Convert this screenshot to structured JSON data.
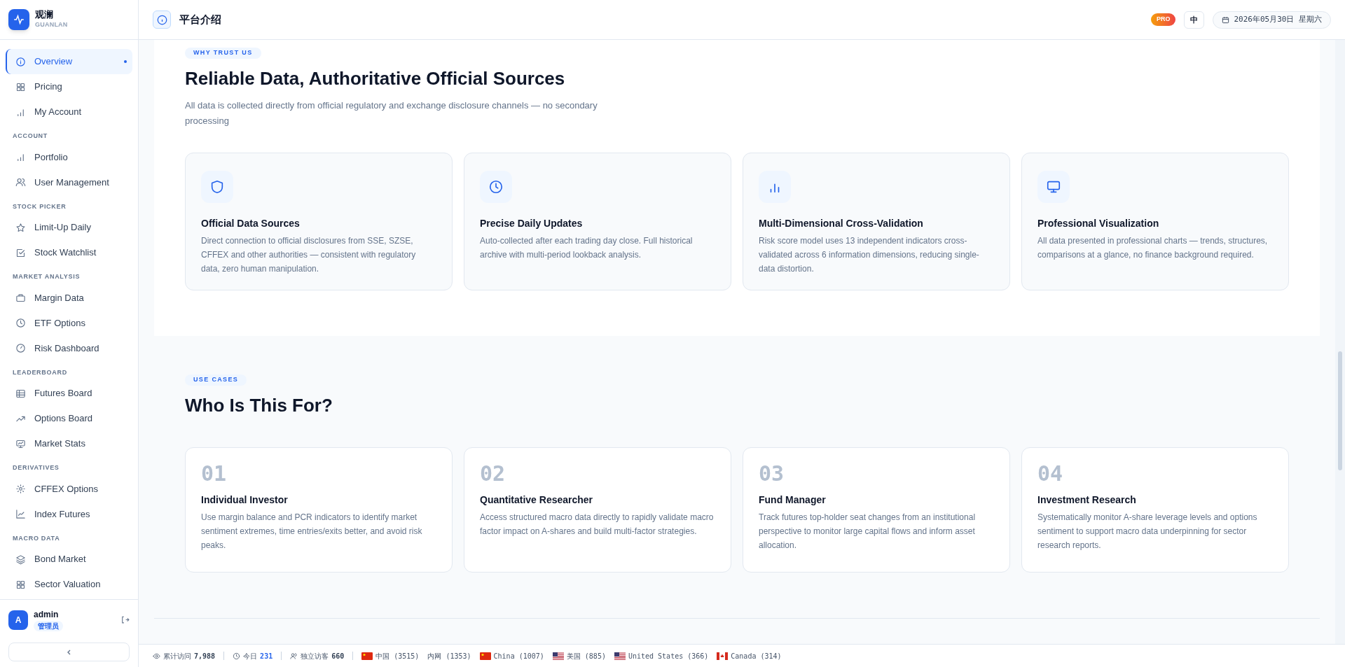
{
  "brand": {
    "name": "观澜",
    "subtitle": "GUANLAN"
  },
  "sidebar": {
    "groups": [
      {
        "items": [
          {
            "label": "Overview",
            "selected": true
          },
          {
            "label": "Pricing",
            "selected": false
          },
          {
            "label": "My Account",
            "selected": false
          }
        ]
      },
      {
        "heading": "ACCOUNT",
        "items": [
          {
            "label": "Portfolio",
            "selected": false
          },
          {
            "label": "User Management",
            "selected": false
          }
        ]
      },
      {
        "heading": "STOCK PICKER",
        "items": [
          {
            "label": "Limit-Up Daily",
            "selected": false
          },
          {
            "label": "Stock Watchlist",
            "selected": false
          }
        ]
      },
      {
        "heading": "MARKET ANALYSIS",
        "items": [
          {
            "label": "Margin Data",
            "selected": false
          },
          {
            "label": "ETF Options",
            "selected": false
          },
          {
            "label": "Risk Dashboard",
            "selected": false
          }
        ]
      },
      {
        "heading": "LEADERBOARD",
        "items": [
          {
            "label": "Futures Board",
            "selected": false
          },
          {
            "label": "Options Board",
            "selected": false
          },
          {
            "label": "Market Stats",
            "selected": false
          }
        ]
      },
      {
        "heading": "DERIVATIVES",
        "items": [
          {
            "label": "CFFEX Options",
            "selected": false
          },
          {
            "label": "Index Futures",
            "selected": false
          }
        ]
      },
      {
        "heading": "MACRO DATA",
        "items": [
          {
            "label": "Bond Market",
            "selected": false
          },
          {
            "label": "Sector Valuation",
            "selected": false
          }
        ]
      }
    ],
    "user": {
      "avatar": "A",
      "name": "admin",
      "role": "管理员"
    }
  },
  "header": {
    "title": "平台介绍",
    "badge": "PRO",
    "language": "中",
    "date": "2026年05月30日 星期六"
  },
  "trust": {
    "tag": "WHY TRUST US",
    "title": "Reliable Data, Authoritative Official Sources",
    "subtitle": "All data is collected directly from official regulatory and exchange disclosure channels — no secondary processing",
    "cards": [
      {
        "title": "Official Data Sources",
        "text": "Direct connection to official disclosures from SSE, SZSE, CFFEX and other authorities — consistent with regulatory data, zero human manipulation."
      },
      {
        "title": "Precise Daily Updates",
        "text": "Auto-collected after each trading day close. Full historical archive with multi-period lookback analysis."
      },
      {
        "title": "Multi-Dimensional Cross-Validation",
        "text": "Risk score model uses 13 independent indicators cross-validated across 6 information dimensions, reducing single-data distortion."
      },
      {
        "title": "Professional Visualization",
        "text": "All data presented in professional charts — trends, structures, comparisons at a glance, no finance background required."
      }
    ]
  },
  "use_cases": {
    "tag": "USE CASES",
    "title": "Who Is This For?",
    "cards": [
      {
        "number": "01",
        "title": "Individual Investor",
        "text": "Use margin balance and PCR indicators to identify market sentiment extremes, time entries/exits better, and avoid risk peaks."
      },
      {
        "number": "02",
        "title": "Quantitative Researcher",
        "text": "Access structured macro data directly to rapidly validate macro factor impact on A-shares and build multi-factor strategies."
      },
      {
        "number": "03",
        "title": "Fund Manager",
        "text": "Track futures top-holder seat changes from an institutional perspective to monitor large capital flows and inform asset allocation."
      },
      {
        "number": "04",
        "title": "Investment Research",
        "text": "Systematically monitor A-share leverage levels and options sentiment to support macro data underpinning for sector research reports."
      }
    ]
  },
  "status_bar": {
    "total_label": "累计访问",
    "total": "7,988",
    "today_label": "今日",
    "today": "231",
    "unique_label": "独立访客",
    "unique": "660",
    "regions": [
      {
        "kind": "cn",
        "label": "中国 (3515)"
      },
      {
        "kind": "plain",
        "label": "内网 (1353)"
      },
      {
        "kind": "cn",
        "label": "China (1007)"
      },
      {
        "kind": "us",
        "label": "美国 (885)"
      },
      {
        "kind": "us",
        "label": "United States (366)"
      },
      {
        "kind": "ca",
        "label": "Canada (314)"
      }
    ]
  }
}
